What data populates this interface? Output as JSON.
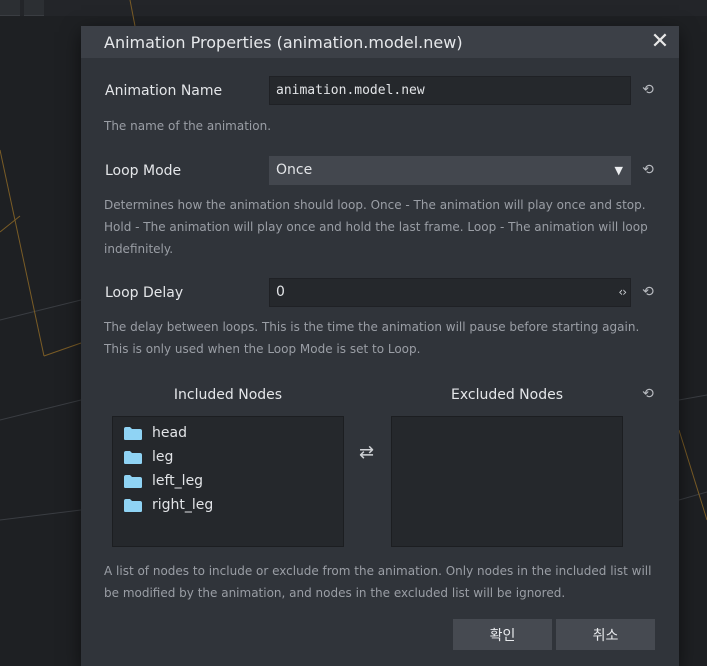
{
  "dialog": {
    "title": "Animation Properties (animation.model.new)",
    "close_glyph": "✕"
  },
  "fields": {
    "name": {
      "label": "Animation Name",
      "value": "animation.model.new",
      "help": "The name of the animation."
    },
    "loop_mode": {
      "label": "Loop Mode",
      "value": "Once",
      "help": "Determines how the animation should loop. Once - The animation will play once and stop. Hold - The animation will play once and hold the last frame. Loop - The animation will loop indefinitely."
    },
    "loop_delay": {
      "label": "Loop Delay",
      "value": "0",
      "help": "The delay between loops. This is the time the animation will pause before starting again. This is only used when the Loop Mode is set to Loop."
    }
  },
  "nodes": {
    "included_header": "Included Nodes",
    "excluded_header": "Excluded Nodes",
    "included": [
      "head",
      "leg",
      "left_leg",
      "right_leg"
    ],
    "excluded": [],
    "help": "A list of nodes to include or exclude from the animation. Only nodes in the included list will be modified by the animation, and nodes in the excluded list will be ignored."
  },
  "buttons": {
    "confirm": "확인",
    "cancel": "취소"
  },
  "icons": {
    "reset": "reset-icon",
    "folder": "folder-icon",
    "swap": "swap-arrows-icon",
    "dropdown": "chevron-down-icon",
    "stepper": "number-stepper-icon"
  },
  "colors": {
    "folder": "#8fd3f4",
    "dialog_bg": "#30343a",
    "titlebar_bg": "#3c4047",
    "viewport_lines": "#8a6a2a"
  }
}
